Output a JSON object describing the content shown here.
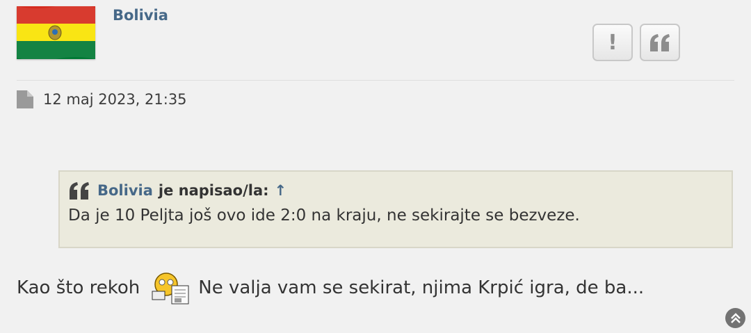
{
  "post": {
    "author": "Bolivia",
    "date": "12 maj 2023, 21:35",
    "buttons": {
      "report_icon": "exclamation-icon",
      "quote_icon": "quote-icon"
    },
    "quote": {
      "author": "Bolivia",
      "wrote": "je napisao/la:",
      "link_arrow": "↑",
      "text": "Da je 10 Peljta još ovo ide 2:0 na kraju, ne sekirajte se bezveze."
    },
    "content_before": "Kao što rekoh",
    "smiley": "reading-newspaper-smiley",
    "content_after": "Ne valja vam se sekirat, njima Krpić igra, de ba..."
  },
  "colors": {
    "background": "#f1f1f1",
    "username": "#466888",
    "quote_bg": "#ebeadd",
    "flag_red": "#d52b1e",
    "flag_yellow": "#f9e300",
    "flag_green": "#007934"
  }
}
